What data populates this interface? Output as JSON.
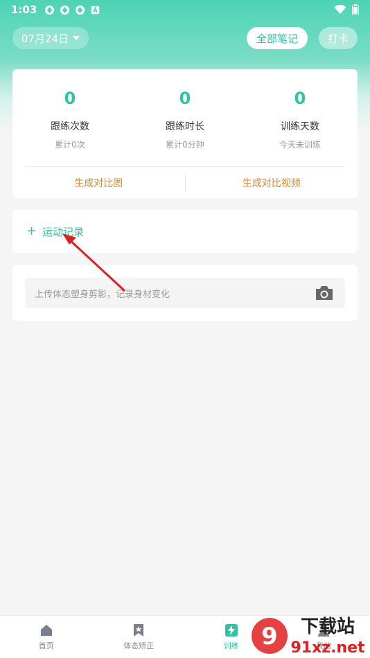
{
  "status_bar": {
    "time": "1:03"
  },
  "header": {
    "date": "07月24日",
    "all_notes_label": "全部笔记",
    "checkin_label": "打卡"
  },
  "stats": [
    {
      "value": "0",
      "label": "跟练次数",
      "sub": "累计0次"
    },
    {
      "value": "0",
      "label": "跟练时长",
      "sub": "累计0分钟"
    },
    {
      "value": "0",
      "label": "训练天数",
      "sub": "今天未训练"
    }
  ],
  "actions": {
    "compare_image": "生成对比图",
    "compare_video": "生成对比视频"
  },
  "record": {
    "label": "运动记录",
    "plus": "+"
  },
  "upload": {
    "placeholder": "上传体态塑身剪影，记录身材变化"
  },
  "tabs": [
    {
      "label": "首页",
      "icon": "home-icon"
    },
    {
      "label": "体态矫正",
      "icon": "bookmark-star-icon"
    },
    {
      "label": "训练",
      "icon": "lightning-icon",
      "active": true
    },
    {
      "label": "我的",
      "icon": "profile-icon"
    }
  ],
  "watermark": {
    "text_cn": "下载站",
    "text_url": "91xz.net",
    "logo_text": "9"
  },
  "colors": {
    "accent": "#2ec5a3",
    "action_orange": "#e08a2e",
    "arrow_red": "#e02020"
  }
}
